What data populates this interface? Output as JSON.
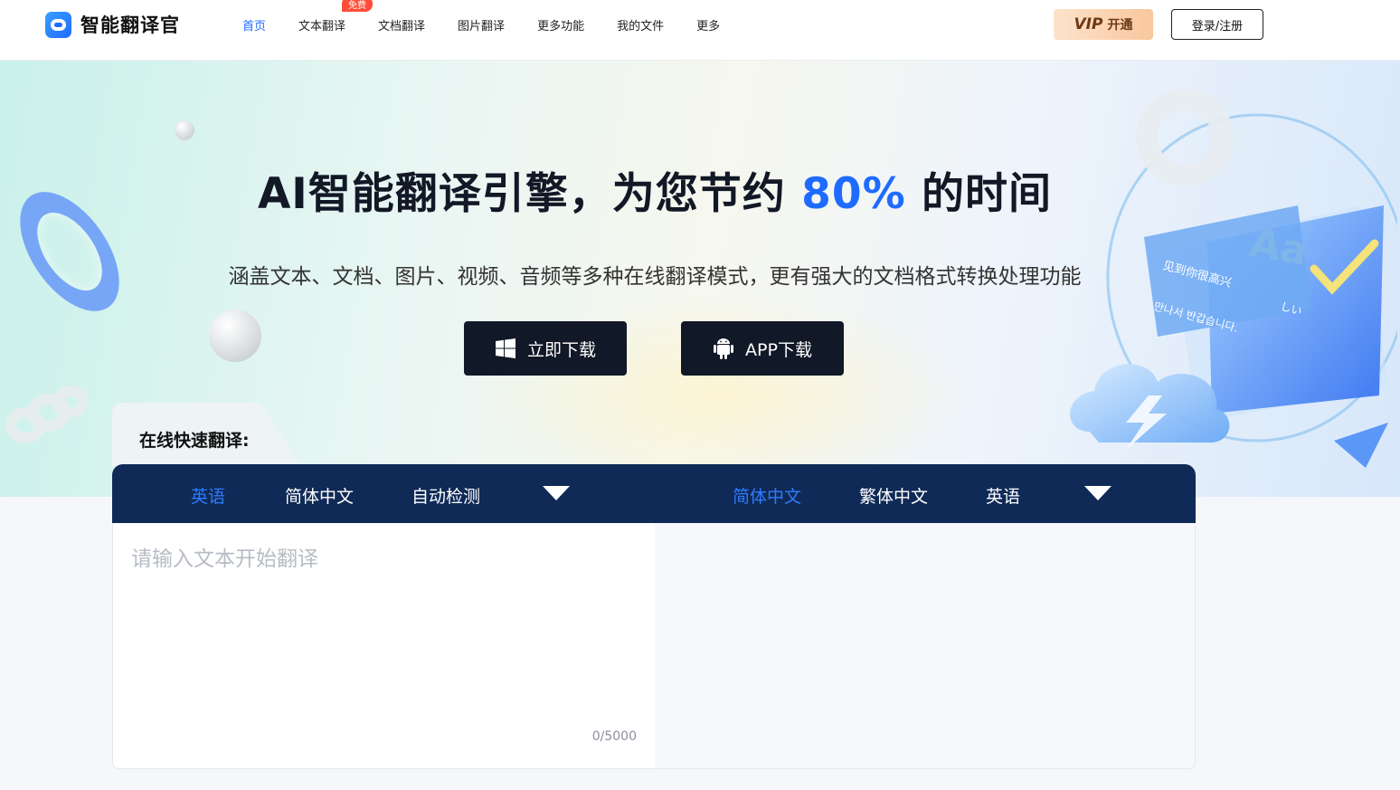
{
  "header": {
    "brand": "智能翻译官",
    "nav": [
      {
        "label": "首页",
        "active": true
      },
      {
        "label": "文本翻译",
        "badge": "免费"
      },
      {
        "label": "文档翻译"
      },
      {
        "label": "图片翻译"
      },
      {
        "label": "更多功能"
      },
      {
        "label": "我的文件"
      },
      {
        "label": "更多"
      }
    ],
    "vip_logo": "VIP",
    "vip_label": "开通",
    "login_label": "登录/注册"
  },
  "hero": {
    "title_prefix": "AI智能翻译引擎，为您节约 ",
    "title_accent": "80%",
    "title_suffix": " 的时间",
    "subtitle": "涵盖文本、文档、图片、视频、音频等多种在线翻译模式，更有强大的文档格式转换处理功能",
    "download_label": "立即下载",
    "app_download_label": "APP下载",
    "card_text_1": "见到你很高兴",
    "card_text_2": "만나서 반갑습니다.",
    "card_text_3": "しい",
    "aa_text": "Aa"
  },
  "translator": {
    "tab_label": "在线快速翻译:",
    "source_langs": [
      {
        "label": "英语",
        "active": true
      },
      {
        "label": "简体中文"
      },
      {
        "label": "自动检测"
      }
    ],
    "target_langs": [
      {
        "label": "简体中文",
        "active": true
      },
      {
        "label": "繁体中文"
      },
      {
        "label": "英语"
      }
    ],
    "placeholder": "请输入文本开始翻译",
    "counter": "0/5000"
  },
  "colors": {
    "accent": "#1f6bff",
    "lang_bar": "#0f2a56",
    "button_dark": "#111827",
    "vip_gradient_start": "#fde3cc"
  }
}
